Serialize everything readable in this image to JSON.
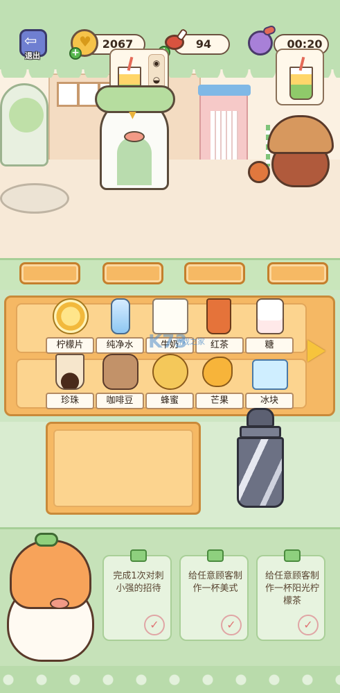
{
  "hud": {
    "exit_label": "退出",
    "coins": "2067",
    "meat": "94",
    "timer": "00:20"
  },
  "scene": {
    "order_hint_icons": [
      "lemon-icon",
      "pear-icon",
      "drop-icon"
    ]
  },
  "ingredients": {
    "row1": [
      {
        "label": "柠檬片",
        "icon": "lemon-slice-icon"
      },
      {
        "label": "纯净水",
        "icon": "water-bottle-icon"
      },
      {
        "label": "牛奶",
        "icon": "milk-jug-icon"
      },
      {
        "label": "红茶",
        "icon": "black-tea-icon"
      },
      {
        "label": "糖",
        "icon": "sugar-jar-icon"
      }
    ],
    "row2": [
      {
        "label": "珍珠",
        "icon": "pearl-cup-icon"
      },
      {
        "label": "咖啡豆",
        "icon": "coffee-bean-sack-icon"
      },
      {
        "label": "蜂蜜",
        "icon": "honey-jar-icon"
      },
      {
        "label": "芒果",
        "icon": "mango-icon"
      },
      {
        "label": "冰块",
        "icon": "ice-cube-icon"
      }
    ]
  },
  "tasks": [
    {
      "text": "完成1次对刺小强的招待",
      "icon": "check-icon"
    },
    {
      "text": "给任意顾客制作一杯美式",
      "icon": "check-icon"
    },
    {
      "text": "给任意顾客制作一杯阳光柠檬茶",
      "icon": "check-icon"
    }
  ],
  "watermark": {
    "brand": "K73",
    "sub": "游戏之家"
  },
  "colors": {
    "hud_bg": "#bfe0b3",
    "shelf": "#f5b864",
    "tag_bg": "#fffaf0",
    "arrow": "#f7c43c"
  }
}
